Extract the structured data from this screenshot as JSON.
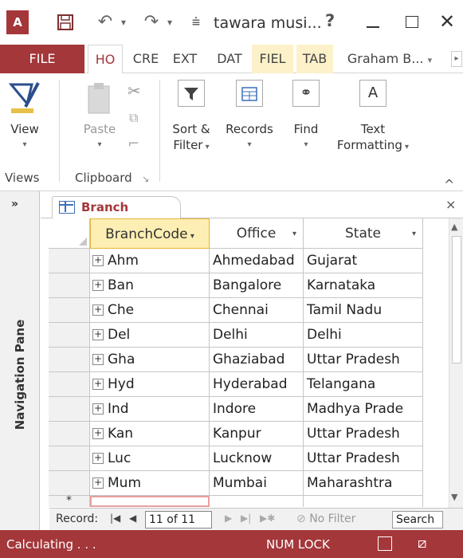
{
  "title_bar": {
    "logo_text": "A",
    "doc_title": "tawara musi...",
    "help": "?",
    "close": "✕"
  },
  "ribbon_tabs": {
    "file": "FILE",
    "home": "HO",
    "create": "CRE",
    "external": "EXT",
    "database": "DAT",
    "fields": "FIEL",
    "table": "TAB",
    "user": "Graham B...",
    "user_dropdown": "▾",
    "scroll": "▸"
  },
  "ribbon": {
    "view_label": "View",
    "paste_label": "Paste",
    "sort_filter_line1": "Sort &",
    "sort_filter_line2": "Filter",
    "records_label": "Records",
    "find_label": "Find",
    "text_format_glyph": "A",
    "text_format_line1": "Text",
    "text_format_line2": "Formatting",
    "groups": {
      "views": "Views",
      "clipboard": "Clipboard"
    },
    "collapse": "^"
  },
  "nav_pane": {
    "label": "Navigation Pane",
    "toggle": "»"
  },
  "doc_tab": {
    "label": "Branch",
    "close": "×"
  },
  "table": {
    "columns": [
      {
        "label": "BranchCode",
        "sorted": true
      },
      {
        "label": "Office",
        "sorted": false
      },
      {
        "label": "State",
        "sorted": false
      }
    ],
    "rows": [
      [
        "Ahm",
        "Ahmedabad",
        "Gujarat"
      ],
      [
        "Ban",
        "Bangalore",
        "Karnataka"
      ],
      [
        "Che",
        "Chennai",
        "Tamil Nadu"
      ],
      [
        "Del",
        "Delhi",
        "Delhi"
      ],
      [
        "Gha",
        "Ghaziabad",
        "Uttar Pradesh"
      ],
      [
        "Hyd",
        "Hyderabad",
        "Telangana"
      ],
      [
        "Ind",
        "Indore",
        "Madhya Prade"
      ],
      [
        "Kan",
        "Kanpur",
        "Uttar Pradesh"
      ],
      [
        "Luc",
        "Lucknow",
        "Uttar Pradesh"
      ],
      [
        "Mum",
        "Mumbai",
        "Maharashtra"
      ]
    ],
    "new_row_marker": "*"
  },
  "record_nav": {
    "label": "Record:",
    "first": "|◀",
    "prev": "◀",
    "position": "11 of 11",
    "next": "▶",
    "last": "▶|",
    "new": "▶✱",
    "filter": "No Filter",
    "search": "Search"
  },
  "status_bar": {
    "status": "Calculating . . .",
    "num_lock": "NUM LOCK"
  },
  "colors": {
    "accent": "#a4373a",
    "sorted_header": "#fdeeb3",
    "contextual_tab": "#fdf1c9"
  }
}
